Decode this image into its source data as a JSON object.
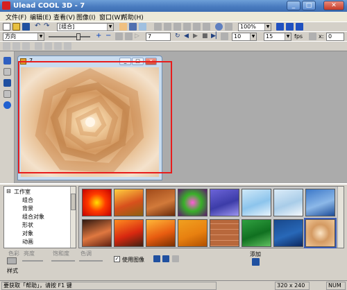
{
  "window": {
    "title": "Ulead COOL 3D - 7"
  },
  "menu": [
    "文件(F)",
    "编辑(E)",
    "查看(V)",
    "图像(I)",
    "窗口(W)",
    "帮助(H)"
  ],
  "toolbar1": {
    "object_combo": "[组合]",
    "zoom_combo": "100%"
  },
  "toolbar2": {
    "direction_combo": "方向",
    "frame_value": "7",
    "speed_value": "10",
    "fps_value": "15",
    "fps_label": "fps",
    "x_label": "x:",
    "x_value": "0"
  },
  "document": {
    "title": "7"
  },
  "tree": {
    "items": [
      "工作室",
      "组合",
      "背景",
      "组合对象",
      "形状",
      "对象",
      "动画"
    ]
  },
  "gallery": {
    "tiles": [
      {
        "name": "sunburst",
        "colors": [
          "#ffe000",
          "#ff3a00",
          "#c20000"
        ]
      },
      {
        "name": "fire-leaves",
        "colors": [
          "#ffcf40",
          "#d8501c",
          "#8c6010"
        ]
      },
      {
        "name": "wood",
        "colors": [
          "#a04a1a",
          "#d27a3a",
          "#6a2a0a"
        ]
      },
      {
        "name": "swirl-purple",
        "colors": [
          "#ff5cd8",
          "#38b028",
          "#601870"
        ]
      },
      {
        "name": "water-purple",
        "colors": [
          "#6c64d8",
          "#3c3ca8",
          "#9c94f0"
        ]
      },
      {
        "name": "ice-light",
        "colors": [
          "#cfe8f8",
          "#8cc4ec",
          "#e8f4fc"
        ]
      },
      {
        "name": "ice-white",
        "colors": [
          "#dcecf8",
          "#a8cce8",
          "#f4f8fc"
        ]
      },
      {
        "name": "clouds-blue",
        "colors": [
          "#3c78c8",
          "#8cb8e8",
          "#1c4c98"
        ]
      },
      {
        "name": "sunset-clouds",
        "colors": [
          "#301810",
          "#e07840",
          "#602010"
        ]
      },
      {
        "name": "sunset-sea",
        "colors": [
          "#ff8c20",
          "#d82810",
          "#402010"
        ]
      },
      {
        "name": "sunset-orange",
        "colors": [
          "#ffb838",
          "#e85c10",
          "#783000"
        ]
      },
      {
        "name": "orange-tiles",
        "colors": [
          "#f0a020",
          "#e88010",
          "#b05000"
        ]
      },
      {
        "name": "brick",
        "colors": [
          "#b8683c",
          "#8c4020",
          "#d89068"
        ]
      },
      {
        "name": "green",
        "colors": [
          "#30a040",
          "#107020",
          "#60c060"
        ]
      },
      {
        "name": "blue-ice",
        "colors": [
          "#18488c",
          "#2868b8",
          "#0c2860"
        ]
      },
      {
        "name": "spiral-selected",
        "colors": [
          "#fbe4c4",
          "#d49a62",
          "#f0c898"
        ]
      }
    ]
  },
  "controls": {
    "color_label": "色彩",
    "brightness_label": "亮度",
    "saturation_label": "饱和度",
    "hue_label": "色调",
    "use_image_label": "使用图像",
    "add_label": "添加",
    "style_label": "样式"
  },
  "status": {
    "help_text": "要获取「帮助」，请按 F1 键",
    "size": "320 x 240",
    "num": "NUM"
  },
  "colors": {
    "title_bar": "#4a7cc0",
    "highlight_rect": "#e81c1c",
    "workspace": "#ababab"
  }
}
